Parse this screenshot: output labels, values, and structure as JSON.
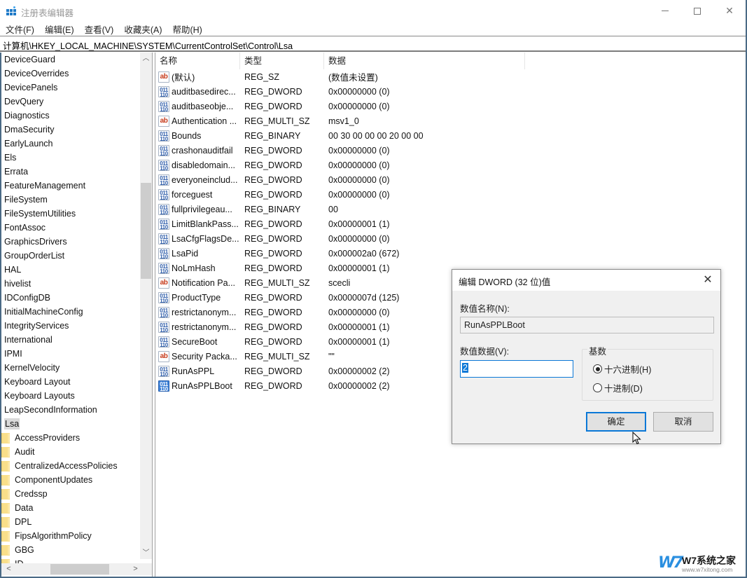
{
  "window": {
    "title": "注册表编辑器",
    "controls": {
      "minimize": "minimize",
      "maximize": "maximize",
      "close": "close"
    }
  },
  "menu": {
    "items": [
      {
        "label": "文件(F)"
      },
      {
        "label": "编辑(E)"
      },
      {
        "label": "查看(V)"
      },
      {
        "label": "收藏夹(A)"
      },
      {
        "label": "帮助(H)"
      }
    ]
  },
  "address": {
    "path": "计算机\\HKEY_LOCAL_MACHINE\\SYSTEM\\CurrentControlSet\\Control\\Lsa"
  },
  "tree": {
    "items": [
      {
        "label": "DeviceGuard"
      },
      {
        "label": "DeviceOverrides"
      },
      {
        "label": "DevicePanels"
      },
      {
        "label": "DevQuery"
      },
      {
        "label": "Diagnostics"
      },
      {
        "label": "DmaSecurity"
      },
      {
        "label": "EarlyLaunch"
      },
      {
        "label": "Els"
      },
      {
        "label": "Errata"
      },
      {
        "label": "FeatureManagement"
      },
      {
        "label": "FileSystem"
      },
      {
        "label": "FileSystemUtilities"
      },
      {
        "label": "FontAssoc"
      },
      {
        "label": "GraphicsDrivers"
      },
      {
        "label": "GroupOrderList"
      },
      {
        "label": "HAL"
      },
      {
        "label": "hivelist"
      },
      {
        "label": "IDConfigDB"
      },
      {
        "label": "InitialMachineConfig"
      },
      {
        "label": "IntegrityServices"
      },
      {
        "label": "International"
      },
      {
        "label": "IPMI"
      },
      {
        "label": "KernelVelocity"
      },
      {
        "label": "Keyboard Layout"
      },
      {
        "label": "Keyboard Layouts"
      },
      {
        "label": "LeapSecondInformation"
      },
      {
        "label": "Lsa",
        "selected": true
      }
    ],
    "children": [
      {
        "label": "AccessProviders"
      },
      {
        "label": "Audit"
      },
      {
        "label": "CentralizedAccessPolicies"
      },
      {
        "label": "ComponentUpdates"
      },
      {
        "label": "Credssp"
      },
      {
        "label": "Data"
      },
      {
        "label": "DPL"
      },
      {
        "label": "FipsAlgorithmPolicy"
      },
      {
        "label": "GBG"
      },
      {
        "label": "ID"
      }
    ]
  },
  "list": {
    "columns": {
      "name": "名称",
      "type": "类型",
      "data": "数据"
    },
    "rows": [
      {
        "icon": "string-value-icon",
        "glyph": "ab",
        "name": "(默认)",
        "type": "REG_SZ",
        "data": "(数值未设置)"
      },
      {
        "icon": "binary-value-icon",
        "glyph": "011\n110",
        "name": "auditbasedirec...",
        "type": "REG_DWORD",
        "data": "0x00000000 (0)"
      },
      {
        "icon": "binary-value-icon",
        "glyph": "011\n110",
        "name": "auditbaseobje...",
        "type": "REG_DWORD",
        "data": "0x00000000 (0)"
      },
      {
        "icon": "string-value-icon",
        "glyph": "ab",
        "name": "Authentication ...",
        "type": "REG_MULTI_SZ",
        "data": "msv1_0"
      },
      {
        "icon": "binary-value-icon",
        "glyph": "011\n110",
        "name": "Bounds",
        "type": "REG_BINARY",
        "data": "00 30 00 00 00 20 00 00"
      },
      {
        "icon": "binary-value-icon",
        "glyph": "011\n110",
        "name": "crashonauditfail",
        "type": "REG_DWORD",
        "data": "0x00000000 (0)"
      },
      {
        "icon": "binary-value-icon",
        "glyph": "011\n110",
        "name": "disabledomain...",
        "type": "REG_DWORD",
        "data": "0x00000000 (0)"
      },
      {
        "icon": "binary-value-icon",
        "glyph": "011\n110",
        "name": "everyoneinclud...",
        "type": "REG_DWORD",
        "data": "0x00000000 (0)"
      },
      {
        "icon": "binary-value-icon",
        "glyph": "011\n110",
        "name": "forceguest",
        "type": "REG_DWORD",
        "data": "0x00000000 (0)"
      },
      {
        "icon": "binary-value-icon",
        "glyph": "011\n110",
        "name": "fullprivilegeau...",
        "type": "REG_BINARY",
        "data": "00"
      },
      {
        "icon": "binary-value-icon",
        "glyph": "011\n110",
        "name": "LimitBlankPass...",
        "type": "REG_DWORD",
        "data": "0x00000001 (1)"
      },
      {
        "icon": "binary-value-icon",
        "glyph": "011\n110",
        "name": "LsaCfgFlagsDe...",
        "type": "REG_DWORD",
        "data": "0x00000000 (0)"
      },
      {
        "icon": "binary-value-icon",
        "glyph": "011\n110",
        "name": "LsaPid",
        "type": "REG_DWORD",
        "data": "0x000002a0 (672)"
      },
      {
        "icon": "binary-value-icon",
        "glyph": "011\n110",
        "name": "NoLmHash",
        "type": "REG_DWORD",
        "data": "0x00000001 (1)"
      },
      {
        "icon": "string-value-icon",
        "glyph": "ab",
        "name": "Notification Pa...",
        "type": "REG_MULTI_SZ",
        "data": "scecli"
      },
      {
        "icon": "binary-value-icon",
        "glyph": "011\n110",
        "name": "ProductType",
        "type": "REG_DWORD",
        "data": "0x0000007d (125)"
      },
      {
        "icon": "binary-value-icon",
        "glyph": "011\n110",
        "name": "restrictanonym...",
        "type": "REG_DWORD",
        "data": "0x00000000 (0)"
      },
      {
        "icon": "binary-value-icon",
        "glyph": "011\n110",
        "name": "restrictanonym...",
        "type": "REG_DWORD",
        "data": "0x00000001 (1)"
      },
      {
        "icon": "binary-value-icon",
        "glyph": "011\n110",
        "name": "SecureBoot",
        "type": "REG_DWORD",
        "data": "0x00000001 (1)"
      },
      {
        "icon": "string-value-icon",
        "glyph": "ab",
        "name": "Security Packa...",
        "type": "REG_MULTI_SZ",
        "data": "\"\""
      },
      {
        "icon": "binary-value-icon",
        "glyph": "011\n110",
        "name": "RunAsPPL",
        "type": "REG_DWORD",
        "data": "0x00000002 (2)"
      },
      {
        "icon": "binary-value-icon",
        "glyph": "011\n110",
        "name": "RunAsPPLBoot",
        "type": "REG_DWORD",
        "data": "0x00000002 (2)",
        "selected": true
      }
    ]
  },
  "dialog": {
    "title": "编辑 DWORD (32 位)值",
    "name_label": "数值名称(N):",
    "name_value": "RunAsPPLBoot",
    "data_label": "数值数据(V):",
    "data_value": "2",
    "base_label": "基数",
    "radio_hex": "十六进制(H)",
    "radio_dec": "十进制(D)",
    "base_selected": "hex",
    "ok_label": "确定",
    "cancel_label": "取消"
  },
  "watermark": {
    "logo": "W7",
    "title": "W7系统之家",
    "url": "www.w7xitong.com"
  }
}
